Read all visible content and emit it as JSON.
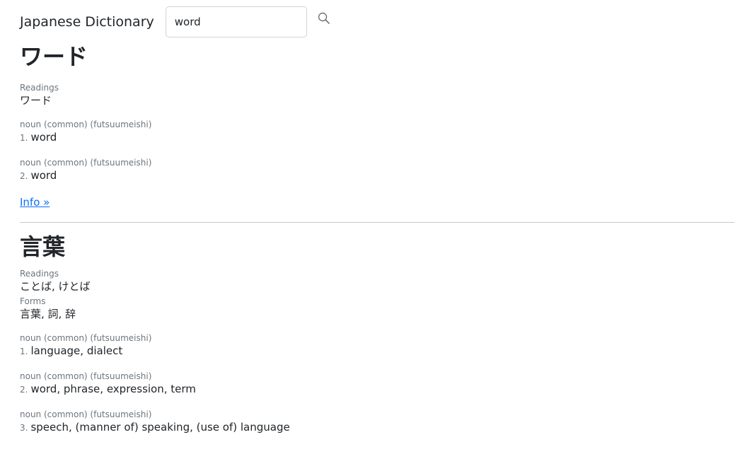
{
  "header": {
    "brand": "Japanese Dictionary",
    "search_value": "word"
  },
  "entries": [
    {
      "title": "ワード",
      "readings_label": "Readings",
      "readings": "ワード",
      "senses": [
        {
          "pos": "noun (common) (futsuumeishi)",
          "num": "1.",
          "gloss": "word"
        },
        {
          "pos": "noun (common) (futsuumeishi)",
          "num": "2.",
          "gloss": "word"
        }
      ],
      "info_link": "Info »"
    },
    {
      "title": "言葉",
      "readings_label": "Readings",
      "readings": "ことば, けとば",
      "forms_label": "Forms",
      "forms": "言葉, 詞, 辞",
      "senses": [
        {
          "pos": "noun (common) (futsuumeishi)",
          "num": "1.",
          "gloss": "language, dialect"
        },
        {
          "pos": "noun (common) (futsuumeishi)",
          "num": "2.",
          "gloss": "word, phrase, expression, term"
        },
        {
          "pos": "noun (common) (futsuumeishi)",
          "num": "3.",
          "gloss": "speech, (manner of) speaking, (use of) language"
        }
      ]
    }
  ],
  "icons": {
    "search": "search-icon"
  },
  "colors": {
    "link": "#0d6efd",
    "muted": "#6c757d",
    "text": "#212529"
  }
}
